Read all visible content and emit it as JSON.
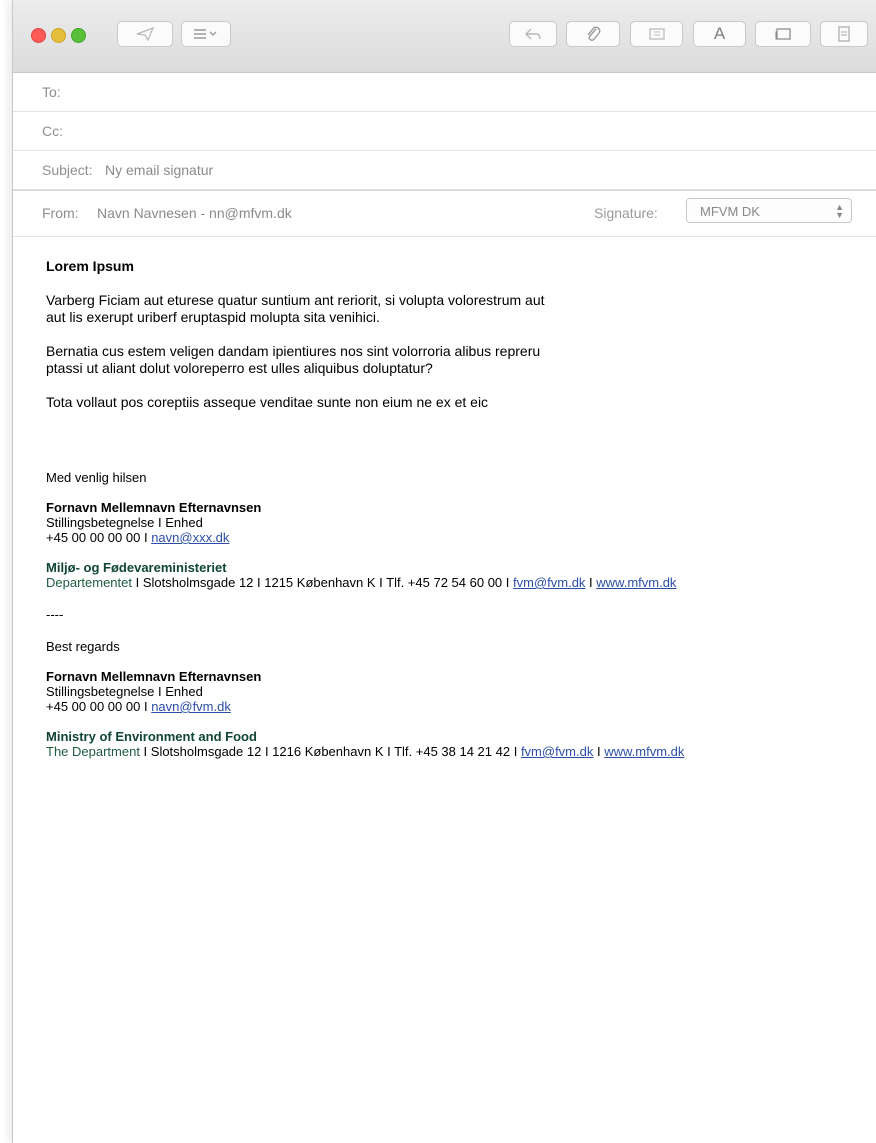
{
  "toolbar": {
    "buttons": [
      {
        "icon": "send-icon",
        "glyph": "⌯"
      },
      {
        "icon": "header-fields-icon",
        "glyph": "≡⌄"
      },
      {
        "icon": "reply-icon",
        "glyph": "⤺"
      },
      {
        "icon": "attachment-icon",
        "glyph": "📎"
      },
      {
        "icon": "insert-photo-icon",
        "glyph": "▭"
      },
      {
        "icon": "format-text-icon",
        "glyph": "A"
      },
      {
        "icon": "photo-browser-icon",
        "glyph": "▭"
      },
      {
        "icon": "stationery-icon",
        "glyph": "▤"
      }
    ]
  },
  "header": {
    "to_label": "To:",
    "cc_label": "Cc:",
    "subject_label": "Subject:",
    "subject_value": "Ny email signatur",
    "from_label": "From:",
    "from_value": "Navn Navnesen - nn@mfvm.dk",
    "signature_label": "Signature:",
    "signature_value": "MFVM DK"
  },
  "body": {
    "heading": "Lorem Ipsum",
    "para1_line1": "Varberg Ficiam aut eturese quatur suntium ant reriorit, si volupta volorestrum aut",
    "para1_line2": "aut lis exerupt uriberf eruptaspid molupta sita venihici.",
    "para2_line1": "Bernatia cus estem veligen dandam ipientiures nos sint volorroria alibus repreru",
    "para2_line2": "ptassi ut aliant dolut voloreperro est ulles aliquibus doluptatur?",
    "para3": "Tota vollaut pos coreptiis asseque venditae sunte non eium ne ex et eic"
  },
  "sig_dk": {
    "greeting": "Med venlig hilsen",
    "name": "Fornavn Mellemnavn Efternavnsen",
    "title": "Stillingsbetegnelse I Enhed",
    "phone": "+45 00 00 00 00 I",
    "email": "navn@xxx.dk",
    "org": "Miljø- og Fødevareministeriet",
    "dept": "Departementet",
    "address": " I Slotsholmsgade 12 I 1215 København K I Tlf. +45 72 54 60 00 I ",
    "org_email": "fvm@fvm.dk",
    "sep": " I ",
    "web": "www.mfvm.dk"
  },
  "separator": "----",
  "sig_en": {
    "greeting": "Best regards",
    "name": "Fornavn Mellemnavn Efternavnsen",
    "title": "Stillingsbetegnelse I Enhed",
    "phone": "+45 00 00 00 00 I",
    "email": "navn@fvm.dk",
    "org": "Ministry of Environment and Food",
    "dept": "The Department",
    "address": " I Slotsholmsgade 12 I 1216 København K I Tlf. +45 38 14 21 42 I ",
    "org_email": "fvm@fvm.dk",
    "sep": " I ",
    "web": "www.mfvm.dk"
  },
  "colors": {
    "close": "#fc5b57",
    "minimize": "#e5bf3c",
    "zoom": "#57c038",
    "org_green": "#1e5c3f",
    "link": "#2b4fa8"
  }
}
